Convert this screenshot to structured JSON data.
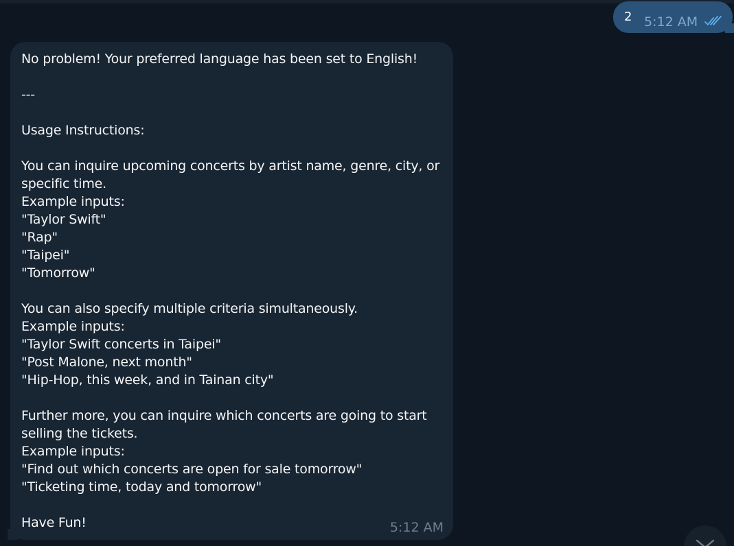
{
  "outgoing_message": {
    "text": "2",
    "time": "5:12 AM",
    "status_icon": "double-check-icon"
  },
  "incoming_message": {
    "text": "No problem! Your preferred language has been set to English!\n\n---\n\nUsage Instructions:\n\nYou can inquire upcoming concerts by artist name, genre, city, or specific time.\nExample inputs:\n\"Taylor Swift\"\n\"Rap\"\n\"Taipei\"\n\"Tomorrow\"\n\nYou can also specify multiple criteria simultaneously.\nExample inputs:\n\"Taylor Swift concerts in Taipei\"\n\"Post Malone, next month\"\n\"Hip-Hop, this week, and in Tainan city\"\n\nFurther more, you can inquire which concerts are going to start selling the tickets.\nExample inputs:\n\"Find out which concerts are open for sale tomorrow\"\n\"Ticketing time, today and tomorrow\"\n\nHave Fun!",
    "time": "5:12 AM"
  },
  "scroll_button": {
    "icon": "chevron-down-icon"
  },
  "colors": {
    "background": "#0e1621",
    "outgoing_bubble": "#2b5278",
    "incoming_bubble": "#182533",
    "outgoing_time": "#7da8d3",
    "incoming_time": "#6d7f8f",
    "check_marks": "#5ab3f0"
  }
}
